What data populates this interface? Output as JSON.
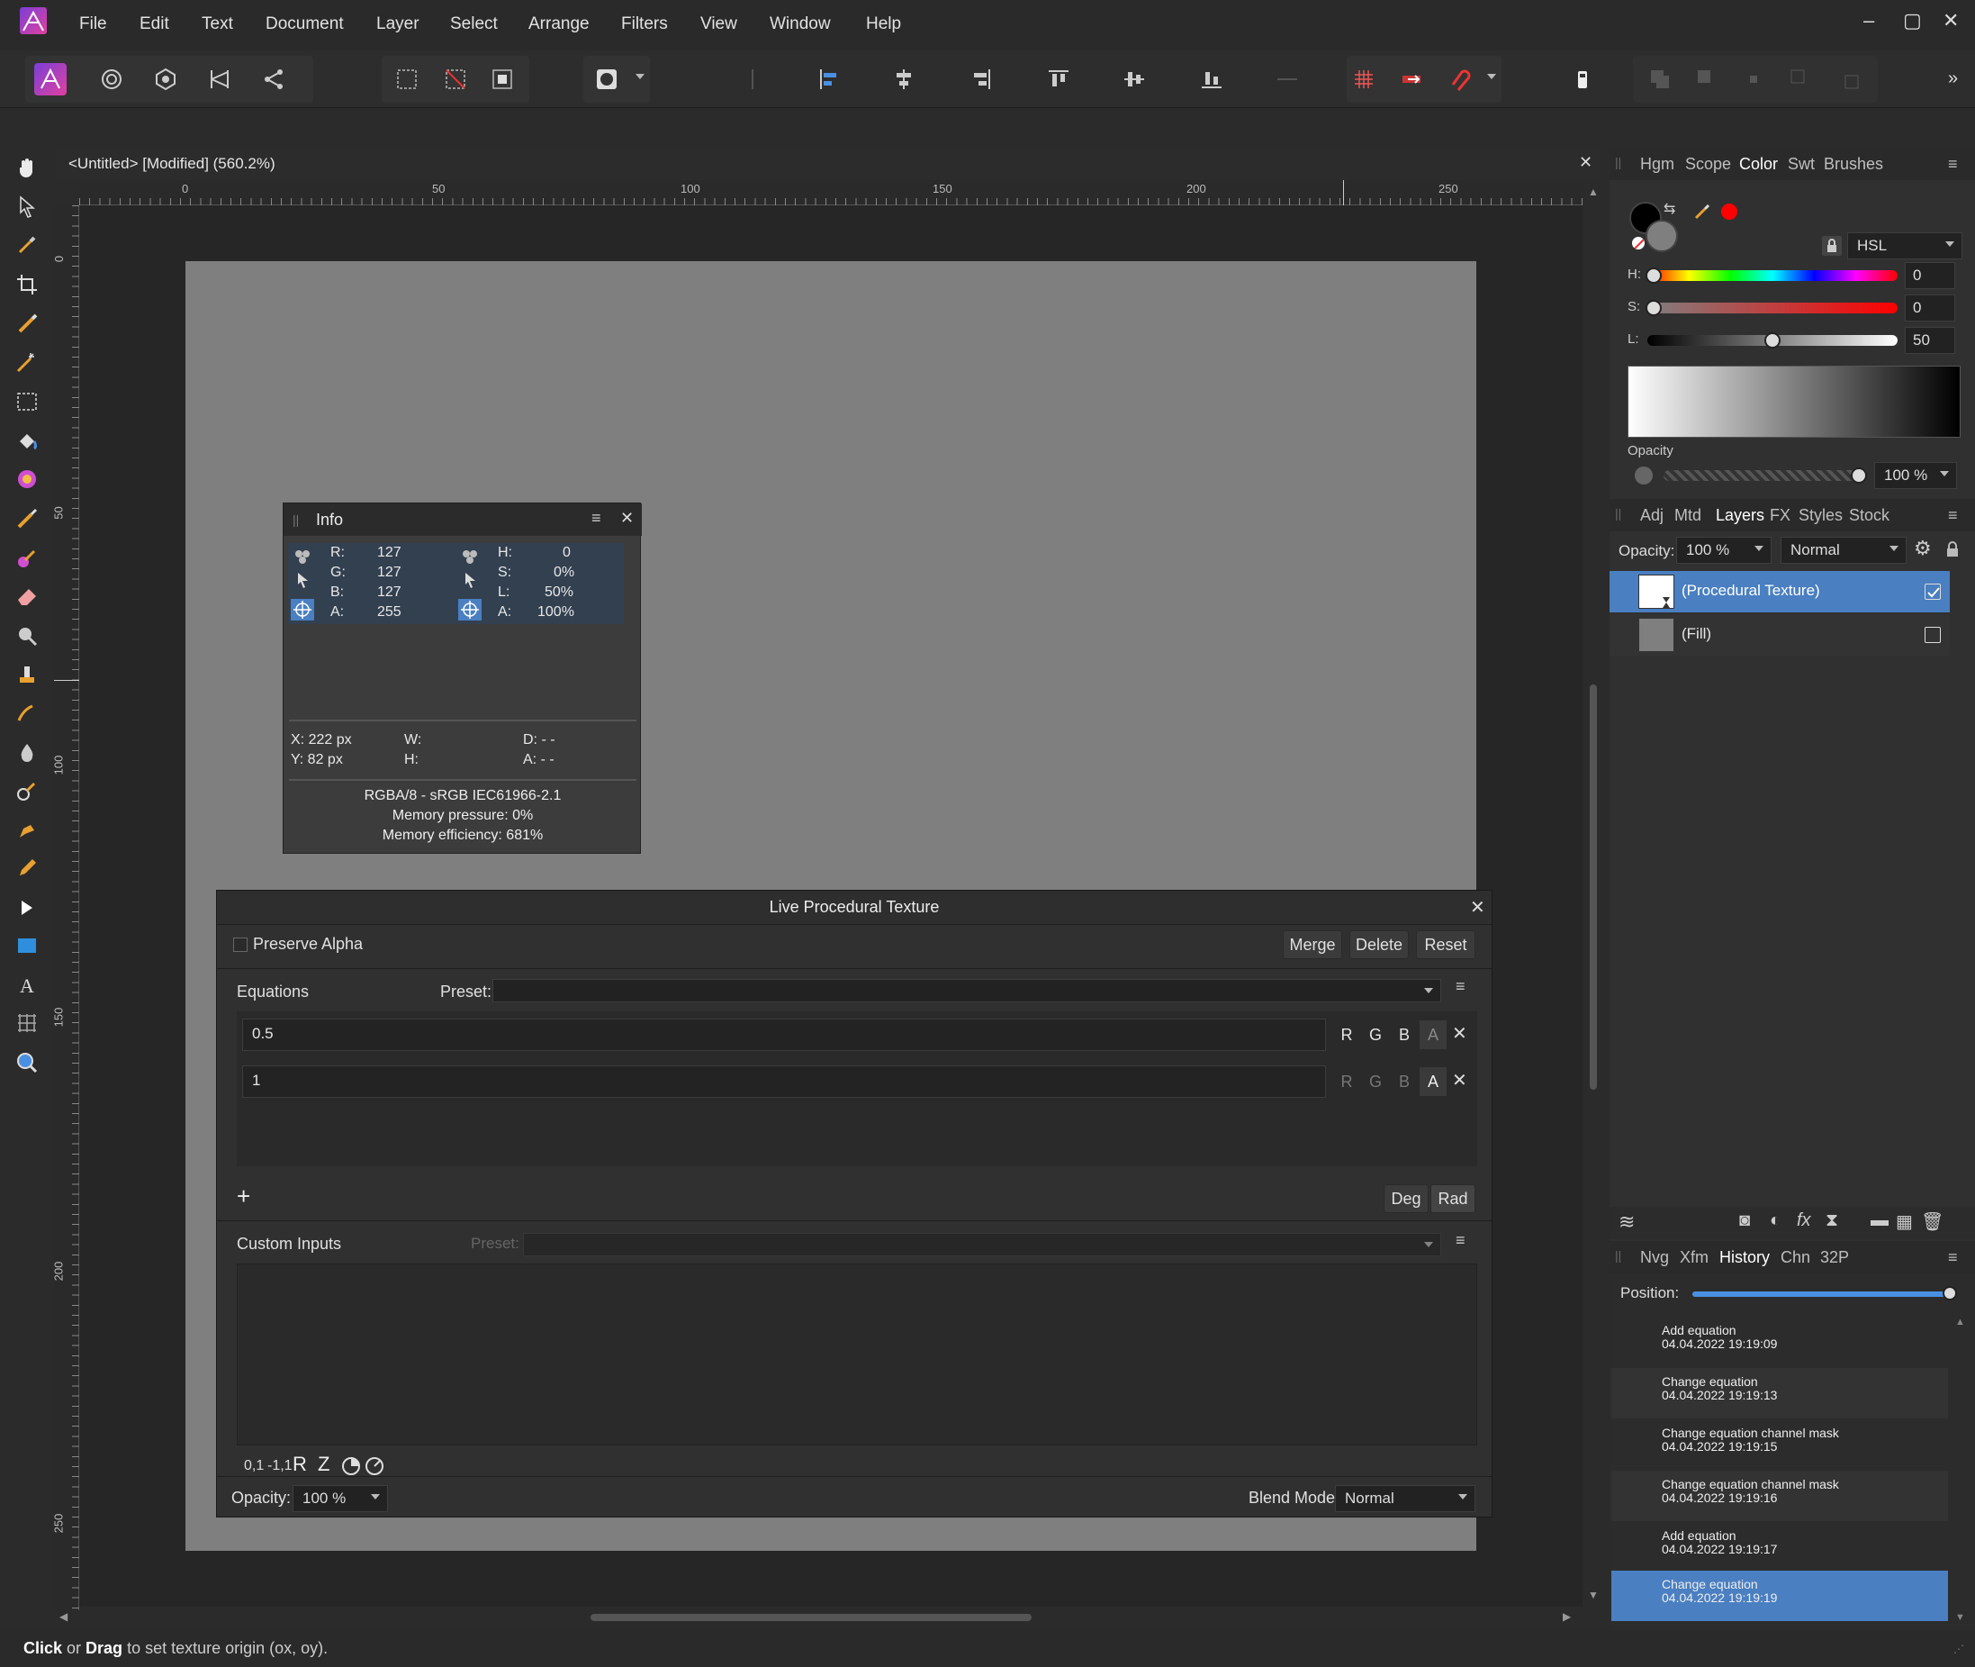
{
  "menu": {
    "items": [
      "File",
      "Edit",
      "Text",
      "Document",
      "Layer",
      "Select",
      "Arrange",
      "Filters",
      "View",
      "Window",
      "Help"
    ],
    "window_controls": [
      "–",
      "▢",
      "✕"
    ]
  },
  "document": {
    "tab_title": "<Untitled> [Modified] (560.2%)",
    "ruler_top": [
      "0",
      "50",
      "100",
      "150",
      "200",
      "250"
    ],
    "ruler_left": [
      "0",
      "50",
      "100",
      "150",
      "200",
      "250"
    ]
  },
  "color_panel": {
    "tabs": [
      "Hgm",
      "Scope",
      "Color",
      "Swt",
      "Brushes"
    ],
    "active_tab": "Color",
    "model": "HSL",
    "h_label": "H:",
    "h_value": "0",
    "s_label": "S:",
    "s_value": "0",
    "l_label": "L:",
    "l_value": "50",
    "opacity_label": "Opacity",
    "opacity_value": "100 %",
    "accent_color": "#ff0000"
  },
  "layers_panel": {
    "tabs": [
      "Adj",
      "Mtd",
      "Layers",
      "FX",
      "Styles",
      "Stock"
    ],
    "active_tab": "Layers",
    "opacity_label": "Opacity:",
    "opacity_value": "100 %",
    "blend_mode": "Normal",
    "layers": [
      {
        "name": "(Procedural Texture)",
        "selected": true,
        "visible": true
      },
      {
        "name": "(Fill)",
        "selected": false,
        "visible": false
      }
    ]
  },
  "history_panel": {
    "tabs": [
      "Nvg",
      "Xfm",
      "History",
      "Chn",
      "32P"
    ],
    "active_tab": "History",
    "position_label": "Position:",
    "position_fraction": 1.0,
    "entries": [
      {
        "action": "Add equation",
        "time": "04.04.2022 19:19:09"
      },
      {
        "action": "Change equation",
        "time": "04.04.2022 19:19:13"
      },
      {
        "action": "Change equation channel mask",
        "time": "04.04.2022 19:19:15"
      },
      {
        "action": "Change equation channel mask",
        "time": "04.04.2022 19:19:16"
      },
      {
        "action": "Add equation",
        "time": "04.04.2022 19:19:17"
      },
      {
        "action": "Change equation",
        "time": "04.04.2022 19:19:19"
      }
    ],
    "selected_index": 5
  },
  "info_panel": {
    "title": "Info",
    "rgb": {
      "r_label": "R:",
      "r": "127",
      "g_label": "G:",
      "g": "127",
      "b_label": "B:",
      "b": "127",
      "a_label": "A:",
      "a": "255"
    },
    "hsl": {
      "h_label": "H:",
      "h": "0",
      "s_label": "S:",
      "s": "0%",
      "l_label": "L:",
      "l": "50%",
      "a_label": "A:",
      "a": "100%"
    },
    "x": "X: 222 px",
    "y": "Y: 82 px",
    "w": "W:",
    "h": "H:",
    "d": "D: - -",
    "angle": "A: - -",
    "format": "RGBA/8 - sRGB IEC61966-2.1",
    "memory_pressure": "Memory pressure: 0%",
    "memory_efficiency": "Memory efficiency: 681%"
  },
  "procedural_texture": {
    "title": "Live Procedural Texture",
    "preserve_alpha": "Preserve Alpha",
    "merge": "Merge",
    "delete": "Delete",
    "reset": "Reset",
    "equations_label": "Equations",
    "preset_label": "Preset:",
    "equations": [
      {
        "value": "0.5",
        "channels": [
          "R",
          "G",
          "B",
          "A"
        ],
        "active_channels": [
          "R",
          "G",
          "B"
        ]
      },
      {
        "value": "1",
        "channels": [
          "R",
          "G",
          "B",
          "A"
        ],
        "active_channels": [
          "A"
        ]
      }
    ],
    "add": "+",
    "deg": "Deg",
    "rad": "Rad",
    "custom_inputs_label": "Custom Inputs",
    "custom_preset_label": "Preset:",
    "input_types": [
      "0,1",
      "-1,1",
      "R",
      "Z"
    ],
    "opacity_label": "Opacity:",
    "opacity_value": "100 %",
    "blend_mode_label": "Blend Mode:",
    "blend_mode_value": "Normal"
  },
  "status": {
    "click": "Click",
    "or": " or ",
    "drag": "Drag",
    "rest": " to set texture origin (ox, oy)."
  }
}
